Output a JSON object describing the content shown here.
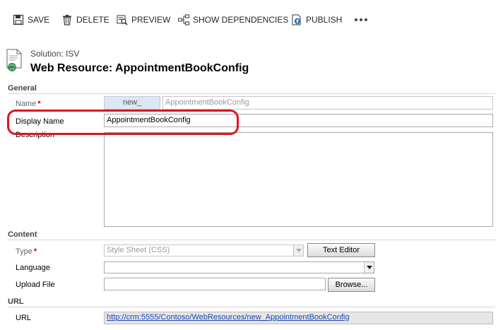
{
  "toolbar": {
    "save": "SAVE",
    "delete": "DELETE",
    "preview": "PREVIEW",
    "show_dependencies": "SHOW DEPENDENCIES",
    "publish": "PUBLISH"
  },
  "header": {
    "solution": "Solution: ISV",
    "title": "Web Resource: AppointmentBookConfig"
  },
  "general": {
    "section_title": "General",
    "name_label": "Name",
    "name_prefix": "new_",
    "name_value": "AppointmentBookConfig",
    "display_name_label": "Display Name",
    "display_name_value": "AppointmentBookConfig",
    "description_label": "Description",
    "description_value": ""
  },
  "content": {
    "section_title": "Content",
    "type_label": "Type",
    "type_value": "Style Sheet (CSS)",
    "text_editor_button": "Text Editor",
    "language_label": "Language",
    "language_value": "",
    "upload_label": "Upload File",
    "upload_value": "",
    "browse_button": "Browse..."
  },
  "url_section": {
    "section_title": "URL",
    "url_label": "URL",
    "url_value": "http://crm:5555/Contoso/WebResources/new_AppointmentBookConfig"
  },
  "required_marker": "*",
  "colors": {
    "highlight": "#e0141e",
    "link": "#1a46b5",
    "required": "#cc0000"
  }
}
